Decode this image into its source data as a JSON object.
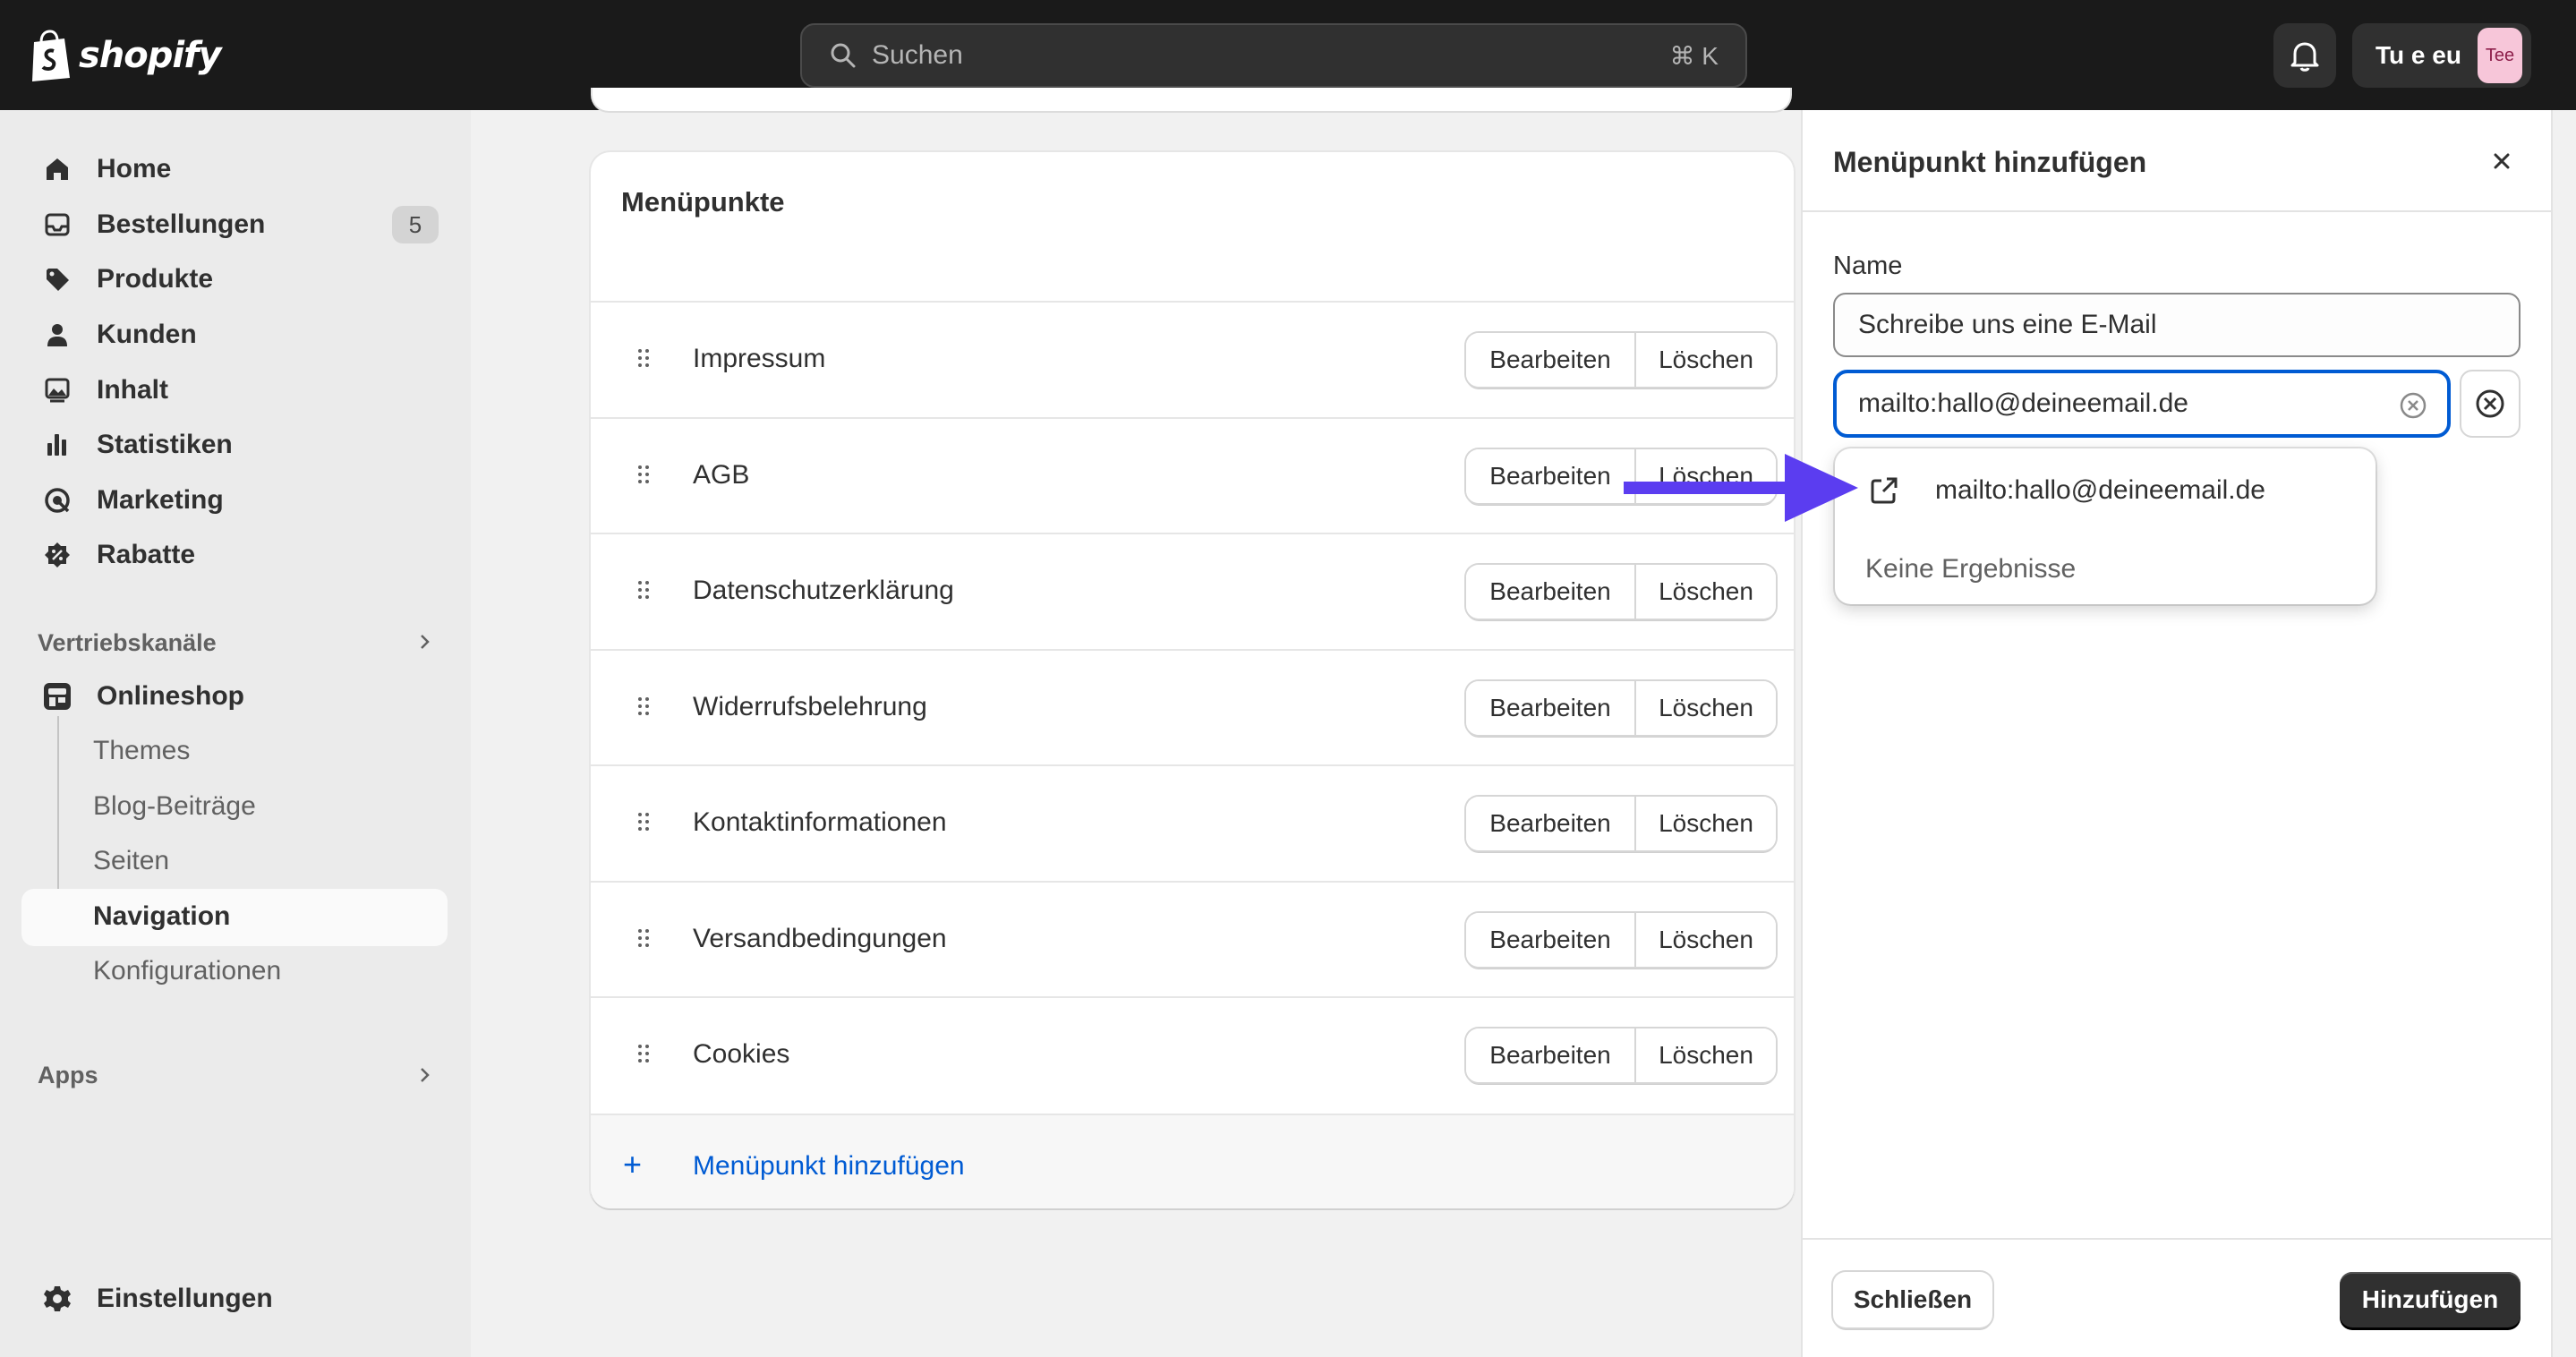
{
  "topbar": {
    "logo_text": "shopify",
    "search_placeholder": "Suchen",
    "search_shortcut": "⌘ K",
    "store_name": "Tu e eu",
    "avatar_text": "Tee"
  },
  "sidebar": {
    "items": [
      {
        "label": "Home",
        "icon": "home-icon"
      },
      {
        "label": "Bestellungen",
        "icon": "inbox-icon",
        "badge": "5"
      },
      {
        "label": "Produkte",
        "icon": "tag-icon"
      },
      {
        "label": "Kunden",
        "icon": "person-icon"
      },
      {
        "label": "Inhalt",
        "icon": "image-icon"
      },
      {
        "label": "Statistiken",
        "icon": "bar-chart-icon"
      },
      {
        "label": "Marketing",
        "icon": "target-icon"
      },
      {
        "label": "Rabatte",
        "icon": "discount-icon"
      }
    ],
    "sales_channels_label": "Vertriebskanäle",
    "onlineshop_label": "Onlineshop",
    "onlineshop_sub": [
      "Themes",
      "Blog-Beiträge",
      "Seiten",
      "Navigation",
      "Konfigurationen"
    ],
    "apps_label": "Apps",
    "settings_label": "Einstellungen"
  },
  "card": {
    "title": "Menüpunkte",
    "rows": [
      "Impressum",
      "AGB",
      "Datenschutzerklärung",
      "Widerrufsbelehrung",
      "Kontaktinformationen",
      "Versandbedingungen",
      "Cookies"
    ],
    "edit_label": "Bearbeiten",
    "delete_label": "Löschen",
    "add_label": "Menüpunkt hinzufügen",
    "add_plus": "+"
  },
  "panel": {
    "title": "Menüpunkt hinzufügen",
    "name_label": "Name",
    "name_value": "Schreibe uns eine E-Mail",
    "link_value": "mailto:hallo@deineemail.de",
    "suggestion": "mailto:hallo@deineemail.de",
    "no_results": "Keine Ergebnisse",
    "close_button": "Schließen",
    "add_button": "Hinzufügen"
  },
  "colors": {
    "accent": "#005bd3",
    "annotation_arrow": "#5b3df0",
    "topbar": "#1a1a1a"
  }
}
